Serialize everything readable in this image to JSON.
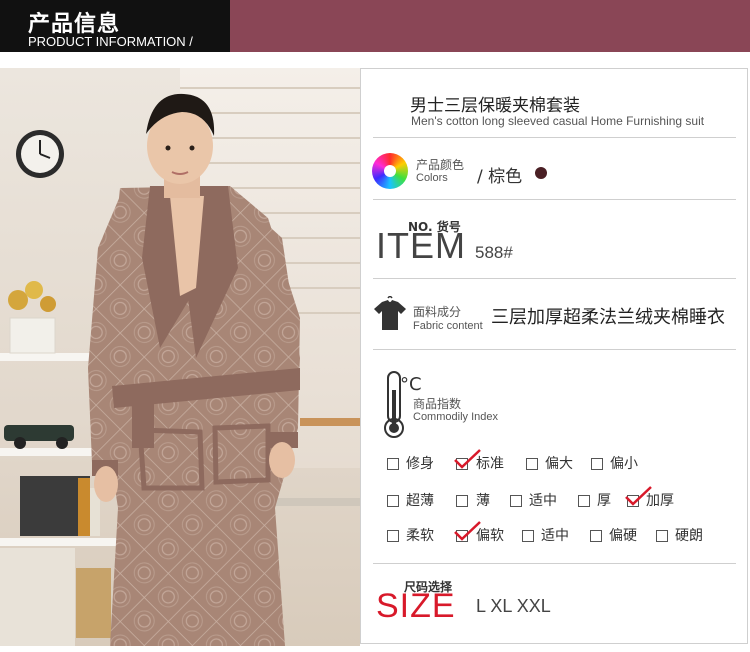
{
  "header": {
    "title_zh": "产品信息",
    "title_en": "PRODUCT INFORMATION /"
  },
  "product": {
    "title_zh": "男士三层保暖夹棉套装",
    "title_en": "Men's cotton long sleeved casual Home Furnishing suit"
  },
  "colors": {
    "label_zh": "产品颜色",
    "label_en": "Colors",
    "value": "/ 棕色",
    "swatch": "#4a1f24"
  },
  "item": {
    "label": "NO. 货号",
    "big": "ITEM",
    "value": "588#"
  },
  "fabric": {
    "label_zh": "面料成分",
    "label_en": "Fabric content",
    "value": "三层加厚超柔法兰绒夹棉睡衣"
  },
  "index": {
    "unit": "°C",
    "label_zh": "商品指数",
    "label_en": "Commodily Index"
  },
  "fit": [
    "修身",
    "标准",
    "偏大",
    "偏小"
  ],
  "thickness": [
    "超薄",
    "薄",
    "适中",
    "厚",
    "加厚"
  ],
  "softness": [
    "柔软",
    "偏软",
    "适中",
    "偏硬",
    "硬朗"
  ],
  "selected": {
    "fit": "标准",
    "thickness": "加厚",
    "softness": "偏软"
  },
  "size": {
    "label": "尺码选择",
    "big": "SIZE",
    "value": "L XL XXL"
  },
  "accent": {
    "maroon": "#8a4656",
    "check_red": "#d8192a"
  }
}
